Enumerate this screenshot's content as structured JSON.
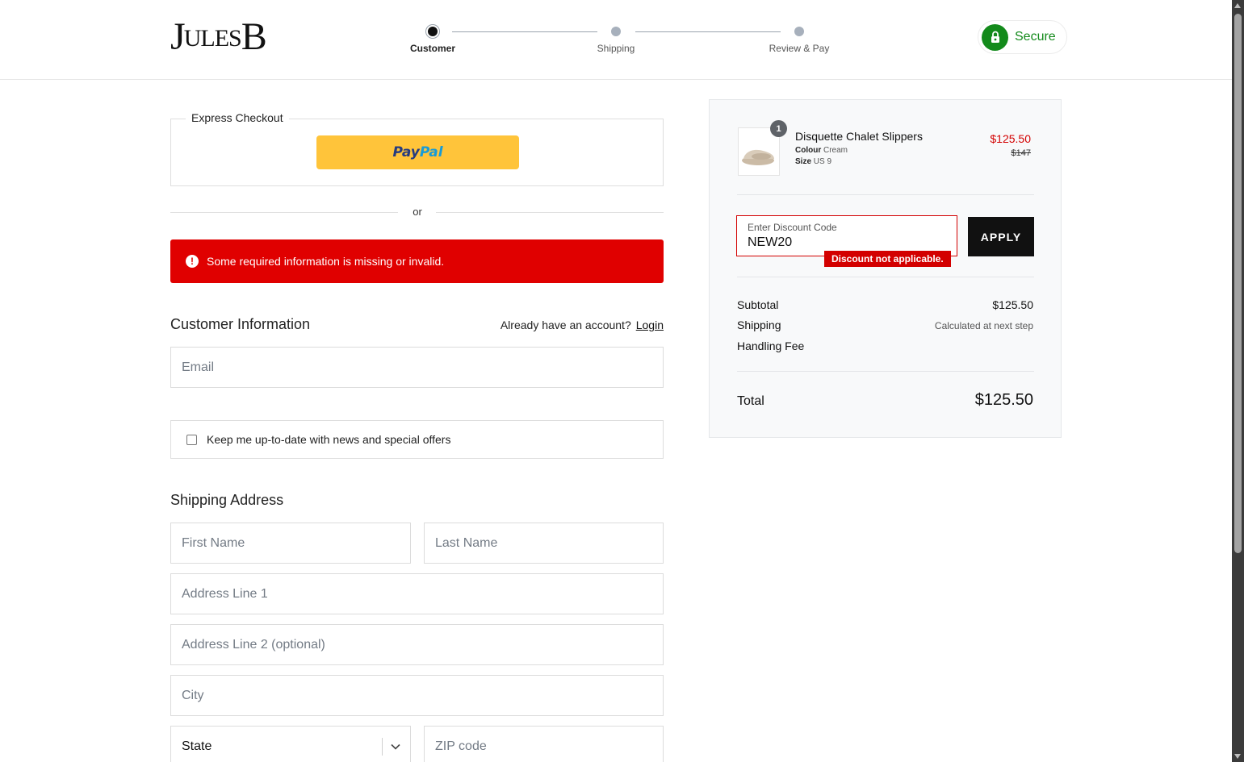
{
  "header": {
    "logo": {
      "part1": "J",
      "part2": "UL",
      "part3": "ES",
      "part4": "B"
    },
    "steps": [
      {
        "label": "Customer",
        "active": true
      },
      {
        "label": "Shipping",
        "active": false
      },
      {
        "label": "Review & Pay",
        "active": false
      }
    ],
    "secure_label": "Secure",
    "secure_color": "#138a1b"
  },
  "express": {
    "legend": "Express Checkout",
    "paypal_part1": "Pay",
    "paypal_part2": "Pal",
    "paypal_color": "#ffc43a"
  },
  "or_label": "or",
  "error": {
    "icon": "!",
    "message": "Some required information is missing or invalid.",
    "color": "#e00000"
  },
  "customer": {
    "title": "Customer Information",
    "account_prompt": "Already have an account?",
    "login_label": "Login",
    "email_placeholder": "Email",
    "newsletter_label": "Keep me up-to-date with news and special offers"
  },
  "shipping": {
    "title": "Shipping Address",
    "first_name_placeholder": "First Name",
    "last_name_placeholder": "Last Name",
    "address1_placeholder": "Address Line 1",
    "address2_placeholder": "Address Line 2 (optional)",
    "city_placeholder": "City",
    "state_value": "State",
    "zip_placeholder": "ZIP code"
  },
  "summary": {
    "item": {
      "quantity": "1",
      "name": "Disquette Chalet Slippers",
      "colour_label": "Colour",
      "colour_value": "Cream",
      "size_label": "Size",
      "size_value": "US 9",
      "sale_price": "$125.50",
      "original_price": "$147"
    },
    "discount": {
      "label": "Enter Discount Code",
      "value": "NEW20",
      "error": "Discount not applicable.",
      "apply_label": "APPLY"
    },
    "subtotal_label": "Subtotal",
    "subtotal_value": "$125.50",
    "shipping_label": "Shipping",
    "shipping_value": "Calculated at next step",
    "handling_label": "Handling Fee",
    "total_label": "Total",
    "total_value": "$125.50",
    "sale_color": "#d30000"
  }
}
